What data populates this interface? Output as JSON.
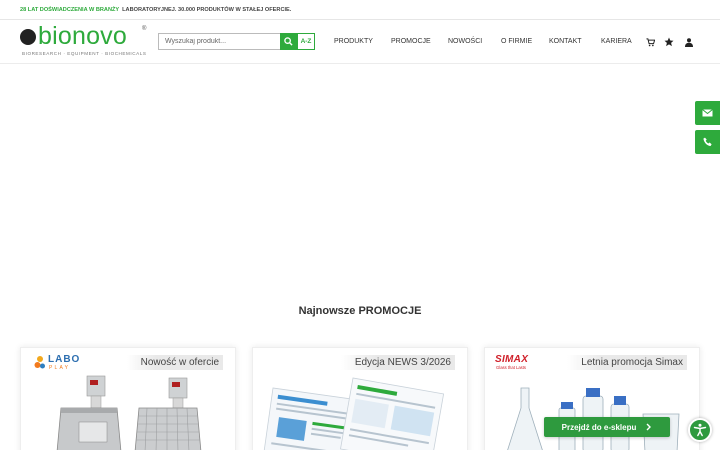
{
  "topbar": {
    "highlight": "28 LAT DOŚWIADCZENIA W BRANŻY",
    "rest": "LABORATORYJNEJ. 30.000 PRODUKTÓW W STAŁEJ OFERCIE."
  },
  "logo": {
    "wordmark": "bionovo",
    "registered": "®",
    "tagline": "BIORESEARCH · EQUIPMENT · BIOCHEMICALS"
  },
  "search": {
    "placeholder": "Wyszukaj produkt...",
    "value": "",
    "az_label": "A-Z"
  },
  "nav": {
    "items": [
      {
        "label": "PRODUKTY"
      },
      {
        "label": "PROMOCJE"
      },
      {
        "label": "NOWOŚCI"
      },
      {
        "label": "O FIRMIE"
      },
      {
        "label": "KONTAKT"
      },
      {
        "label": "KARIERA"
      }
    ]
  },
  "header_icons": [
    "cart-icon",
    "star-icon",
    "user-icon"
  ],
  "side_buttons": [
    "mail-icon",
    "phone-icon"
  ],
  "promotions": {
    "title": "Najnowsze PROMOCJE",
    "cards": [
      {
        "title": "Nowość w ofercie",
        "logo_text": "LABO",
        "logo_sub": "PLAY"
      },
      {
        "title": "Edycja NEWS 3/2026"
      },
      {
        "title": "Letnia promocja Simax",
        "logo_text": "SIMAX",
        "logo_sub": "Glass that Lasts"
      }
    ]
  },
  "cta": {
    "label": "Przejdź do e-sklepu"
  },
  "colors": {
    "brand_green": "#2eaa3c",
    "text": "#333333"
  }
}
